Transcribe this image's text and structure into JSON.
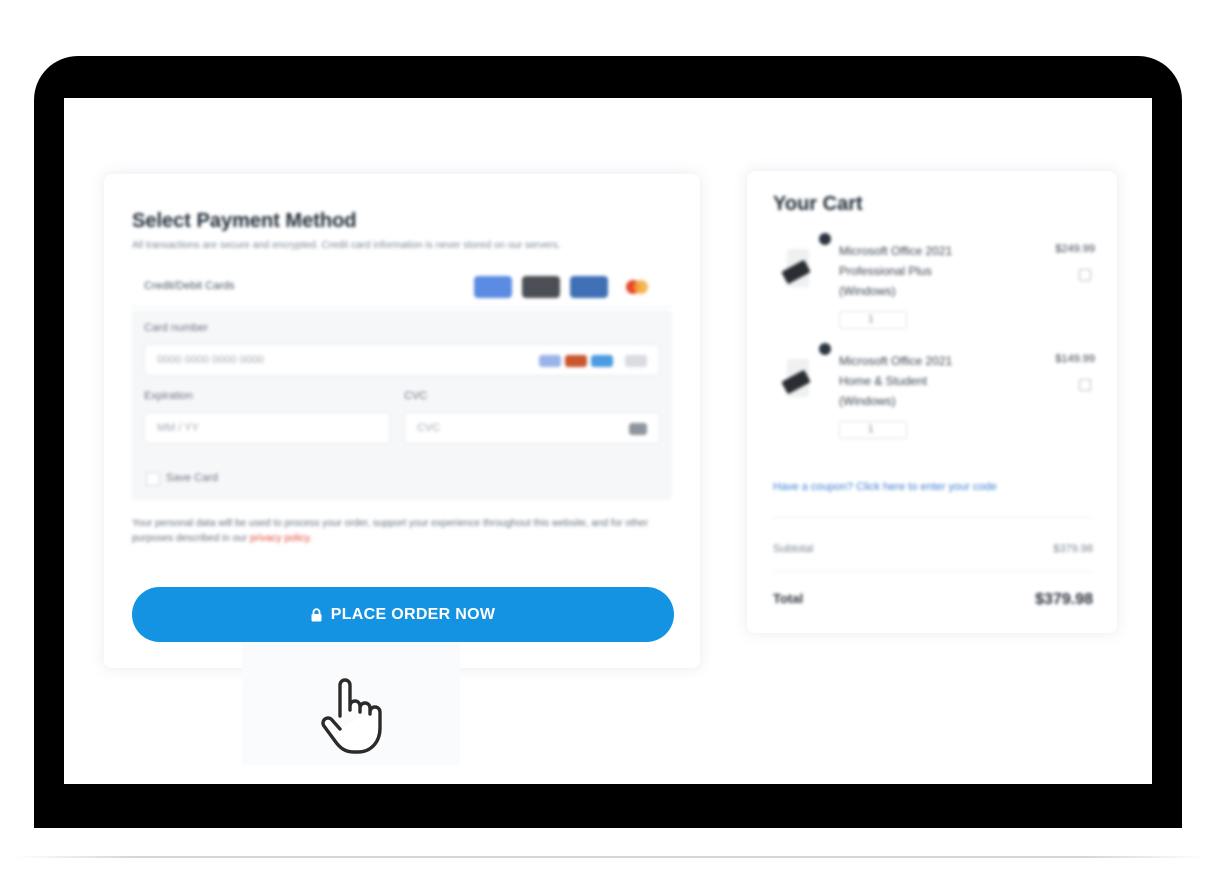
{
  "payment": {
    "title": "Select Payment Method",
    "subtitle": "All transactions are secure and encrypted. Credit card information is never stored on our servers.",
    "option_label": "Credit/Debit Cards",
    "card_number_label": "Card number",
    "card_number_placeholder": "0000 0000 0000 0000",
    "expiration_label": "Expiration",
    "expiration_placeholder": "MM / YY",
    "cvc_label": "CVC",
    "cvc_placeholder": "CVC",
    "save_card_label": "Save Card",
    "disclaimer": "Your personal data will be used to process your order, support your experience throughout this website, and for other purposes described in our",
    "disclaimer_link": "privacy policy.",
    "order_button": "PLACE ORDER NOW"
  },
  "cart": {
    "title": "Your Cart",
    "items": [
      {
        "name": "Microsoft Office 2021 Professional Plus (Windows)",
        "price": "$249.99",
        "qty": "1"
      },
      {
        "name": "Microsoft Office 2021 Home & Student (Windows)",
        "price": "$149.99",
        "qty": "1"
      }
    ],
    "coupon_text": "Have a coupon? Click here to enter your code",
    "subtotal_label": "Subtotal",
    "subtotal_value": "$379.98",
    "total_label": "Total",
    "total_value": "$379.98"
  },
  "colors": {
    "accent": "#1493e2",
    "link": "#3f7fd0",
    "privacy_link": "#e0483b"
  },
  "icons": [
    "lock-icon",
    "hand-cursor-icon",
    "visa-icon",
    "mastercard-icon",
    "amex-icon",
    "discover-icon",
    "trash-icon"
  ]
}
